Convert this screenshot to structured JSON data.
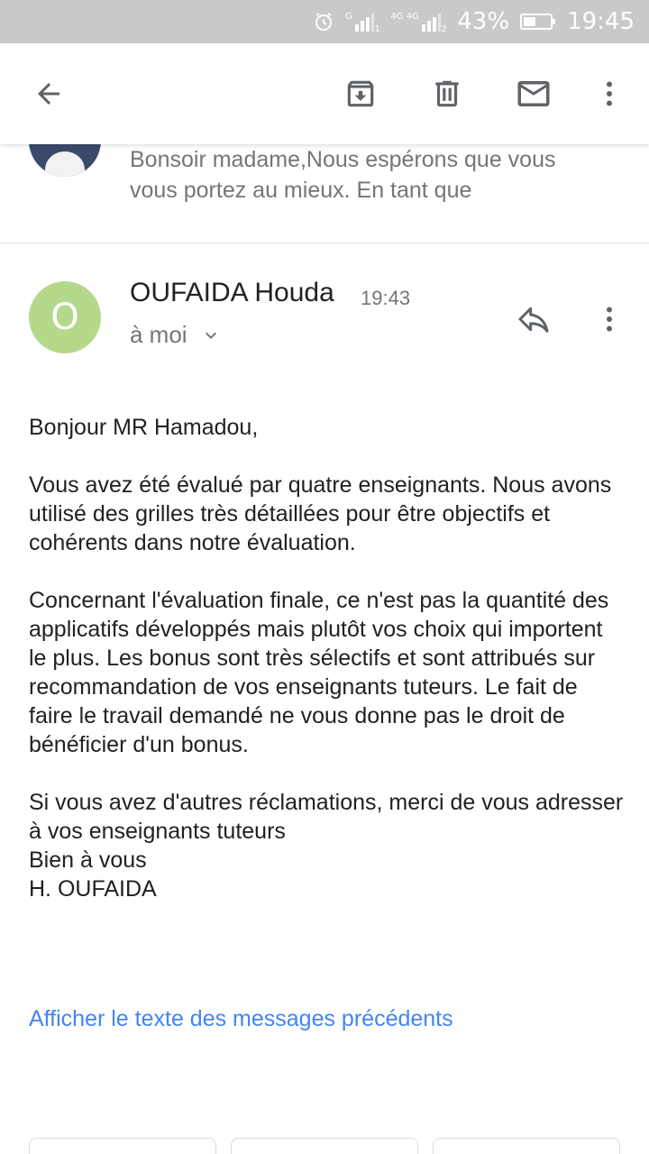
{
  "status_bar": {
    "network_g": "G",
    "network_4g": "4G 4G",
    "sim1": "1",
    "sim2": "2",
    "battery_percent": "43%",
    "time": "19:45",
    "icons": [
      "alarm-icon",
      "signal-icon",
      "battery-icon"
    ]
  },
  "toolbar": {
    "icons": [
      "back-arrow-icon",
      "archive-icon",
      "delete-icon",
      "mark-unread-icon",
      "more-vert-icon"
    ]
  },
  "previous_message": {
    "snippet": "Bonsoir madame,Nous espérons que vous vous portez au mieux. En tant que"
  },
  "message": {
    "avatar_letter": "O",
    "avatar_color": "#b5d98a",
    "sender": "OUFAIDA Houda",
    "time": "19:43",
    "recipient": "à moi",
    "body": {
      "greeting": "Bonjour MR Hamadou,",
      "paragraph1": "Vous avez été évalué par quatre enseignants. Nous avons utilisé des grilles très détaillées pour être objectifs et cohérents dans notre évaluation.",
      "paragraph2": "Concernant l'évaluation finale, ce n'est pas la quantité des applicatifs développés mais plutôt vos choix qui importent le plus. Les bonus sont très sélectifs et sont attribués sur recommandation de vos enseignants tuteurs.  Le fait de faire le travail demandé ne vous donne pas le droit de bénéficier d'un bonus.",
      "line1": "Si vous avez d'autres réclamations, merci de vous adresser à vos enseignants tuteurs",
      "line2": "Bien à vous",
      "signature": "H. OUFAIDA"
    },
    "show_previous_link": "Afficher le texte des messages précédents"
  },
  "colors": {
    "link": "#4285f4",
    "status_bar_bg": "#c9c9c9",
    "secondary_text": "#757575",
    "icon": "#5f6368"
  }
}
